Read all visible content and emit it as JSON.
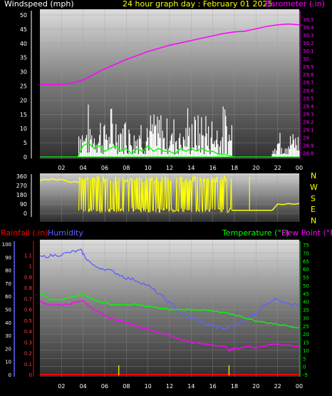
{
  "header": {
    "windspeed_label": "Windspeed (mph)",
    "title": "24 hour graph day : February 01 2025",
    "barometer_label": "Barometer (.in)"
  },
  "compass_letters": [
    "N",
    "W",
    "S",
    "E",
    "N"
  ],
  "bottom_labels": {
    "rainfall": "Rainfall (.in)",
    "humidity": "Humidity",
    "temperature": "Temperature (°F)",
    "dewpoint": "Dew Point (°F)"
  },
  "colors": {
    "windspeed": "#ffffff",
    "wind_avg": "#00ff00",
    "barometer": "#ff00ff",
    "direction": "#ffff00",
    "rainfall": "#ff0000",
    "humidity": "#6060ff",
    "temperature": "#00ff00",
    "dewpoint": "#ff00ff",
    "rain_ticks": "#ffff00"
  },
  "chart_data": [
    {
      "type": "line",
      "title": "24 hour graph day : February 01 2025",
      "x_ticks": [
        "02",
        "04",
        "06",
        "08",
        "10",
        "12",
        "14",
        "16",
        "18",
        "20",
        "22",
        "00"
      ],
      "x_range_hours": [
        0,
        24
      ],
      "y_left": {
        "label": "Windspeed (mph)",
        "range": [
          0,
          50
        ],
        "ticks": [
          0,
          5,
          10,
          15,
          20,
          25,
          30,
          35,
          40,
          45,
          50
        ]
      },
      "y_right": {
        "label": "Barometer (.in)",
        "range": [
          28.75,
          30.6
        ],
        "ticks": [
          28.8,
          28.9,
          29,
          29.1,
          29.2,
          29.3,
          29.4,
          29.5,
          29.6,
          29.7,
          29.8,
          29.9,
          30,
          30.1,
          30.2,
          30.3,
          30.4,
          30.5
        ]
      },
      "series": [
        {
          "name": "Windspeed (mph)",
          "axis": "left",
          "style": "gust-bars",
          "active_range_hours": [
            3.6,
            17.8
          ],
          "second_active_range_hours": [
            21.5,
            24
          ],
          "peak": 20
        },
        {
          "name": "Average",
          "axis": "left",
          "x": [
            3.5,
            4,
            4.5,
            5,
            5.5,
            6,
            6.5,
            7,
            7.5,
            8,
            8.5,
            9,
            9.5,
            10,
            10.5,
            11,
            11.5,
            12,
            12.5,
            13,
            13.5,
            14,
            14.5,
            15,
            15.5,
            16,
            16.5,
            17,
            17.5,
            18
          ],
          "values": [
            0,
            4,
            5,
            3,
            4,
            2,
            3,
            4,
            2,
            3,
            1,
            3,
            2,
            4,
            2,
            3,
            2,
            2,
            1,
            3,
            2,
            3,
            2,
            3,
            2,
            2,
            1,
            1,
            0.5,
            0
          ]
        },
        {
          "name": "Barometer (.in)",
          "axis": "right",
          "x": [
            0,
            2,
            3,
            4,
            5,
            6,
            7,
            8,
            9,
            10,
            11,
            12,
            13,
            14,
            15,
            16,
            17,
            18,
            19,
            20,
            21,
            22,
            23,
            24
          ],
          "values": [
            29.67,
            29.67,
            29.69,
            29.73,
            29.8,
            29.87,
            29.93,
            29.99,
            30.04,
            30.09,
            30.13,
            30.17,
            30.2,
            30.23,
            30.26,
            30.29,
            30.32,
            30.34,
            30.35,
            30.38,
            30.41,
            30.43,
            30.44,
            30.43
          ]
        }
      ]
    },
    {
      "type": "line",
      "title": "",
      "x_range_hours": [
        0,
        24
      ],
      "y": {
        "range": [
          0,
          360
        ],
        "ticks": [
          0,
          90,
          180,
          270,
          360
        ]
      },
      "series": [
        {
          "name": "",
          "x": [
            0,
            0.4,
            0.8,
            1.2,
            1.6,
            2.0,
            2.4,
            2.8,
            3.2,
            3.6,
            17.8,
            18.5,
            19.5,
            20.5,
            21.5,
            22.0,
            22.5,
            23.0,
            23.5,
            24.0
          ],
          "values": [
            318,
            330,
            325,
            335,
            322,
            330,
            318,
            300,
            310,
            300,
            30,
            30,
            30,
            30,
            30,
            90,
            85,
            95,
            88,
            95
          ]
        }
      ]
    },
    {
      "type": "line",
      "title": "",
      "x_ticks": [
        "02",
        "04",
        "06",
        "08",
        "10",
        "12",
        "14",
        "16",
        "18",
        "20",
        "22",
        "00"
      ],
      "x_range_hours": [
        0,
        24
      ],
      "y_far_left": {
        "label": "Humidity",
        "range": [
          0,
          100
        ],
        "ticks": [
          0,
          10,
          20,
          30,
          40,
          50,
          60,
          70,
          80,
          90,
          100
        ]
      },
      "y_left": {
        "label": "Rainfall (.in)",
        "range": [
          0,
          1.2
        ],
        "ticks": [
          0,
          0.1,
          0.2,
          0.3,
          0.4,
          0.5,
          0.6,
          0.7,
          0.8,
          0.9,
          1,
          1.1
        ]
      },
      "y_right": {
        "label": "Temperature (°F)",
        "range": [
          -5,
          75
        ],
        "ticks": [
          -5,
          0,
          5,
          10,
          15,
          20,
          25,
          30,
          35,
          40,
          45,
          50,
          55,
          60,
          65,
          70,
          75
        ]
      },
      "series": [
        {
          "name": "Humidity",
          "axis": "far-left",
          "x": [
            0,
            1,
            2,
            3,
            3.8,
            4.2,
            5,
            6,
            7,
            8,
            9,
            10,
            11,
            12,
            13,
            14,
            15,
            16,
            17,
            18,
            19,
            20,
            21,
            22,
            23,
            24
          ],
          "values": [
            90,
            91,
            92,
            94,
            95,
            90,
            83,
            81,
            78,
            74,
            72,
            68,
            62,
            55,
            48,
            43,
            40,
            37,
            35,
            38,
            42,
            47,
            55,
            58,
            55,
            53
          ]
        },
        {
          "name": "Temperature (°F)",
          "axis": "right",
          "x": [
            0,
            0.5,
            1,
            2,
            3,
            4,
            5,
            6,
            7,
            8,
            9,
            10,
            11,
            12,
            13,
            14,
            15,
            16,
            17,
            18,
            19,
            20,
            21,
            22,
            23,
            24
          ],
          "values": [
            45,
            43,
            41,
            41,
            43,
            45,
            41,
            39,
            38,
            38,
            38,
            37,
            36,
            35,
            35,
            35,
            35,
            34,
            33,
            32,
            30,
            28,
            27,
            26,
            25,
            24
          ]
        },
        {
          "name": "Dew Point (°F)",
          "axis": "right",
          "x": [
            0,
            1,
            2,
            3,
            4,
            5,
            6,
            7,
            8,
            9,
            10,
            11,
            12,
            13,
            14,
            15,
            16,
            17,
            17.5,
            18,
            19,
            20,
            21,
            22,
            23,
            24
          ],
          "values": [
            40,
            38,
            38,
            39,
            41,
            35,
            31,
            29,
            27,
            25,
            23,
            21,
            19,
            17,
            15,
            14,
            13,
            13,
            10,
            11,
            12,
            12,
            13,
            14,
            13,
            12
          ]
        },
        {
          "name": "Rainfall (.in)",
          "axis": "left",
          "x": [
            0,
            24
          ],
          "values": [
            0,
            0
          ]
        },
        {
          "name": "",
          "style": "ticks",
          "x": [
            7.3,
            17.5
          ],
          "values": [
            1,
            1
          ]
        }
      ]
    }
  ]
}
